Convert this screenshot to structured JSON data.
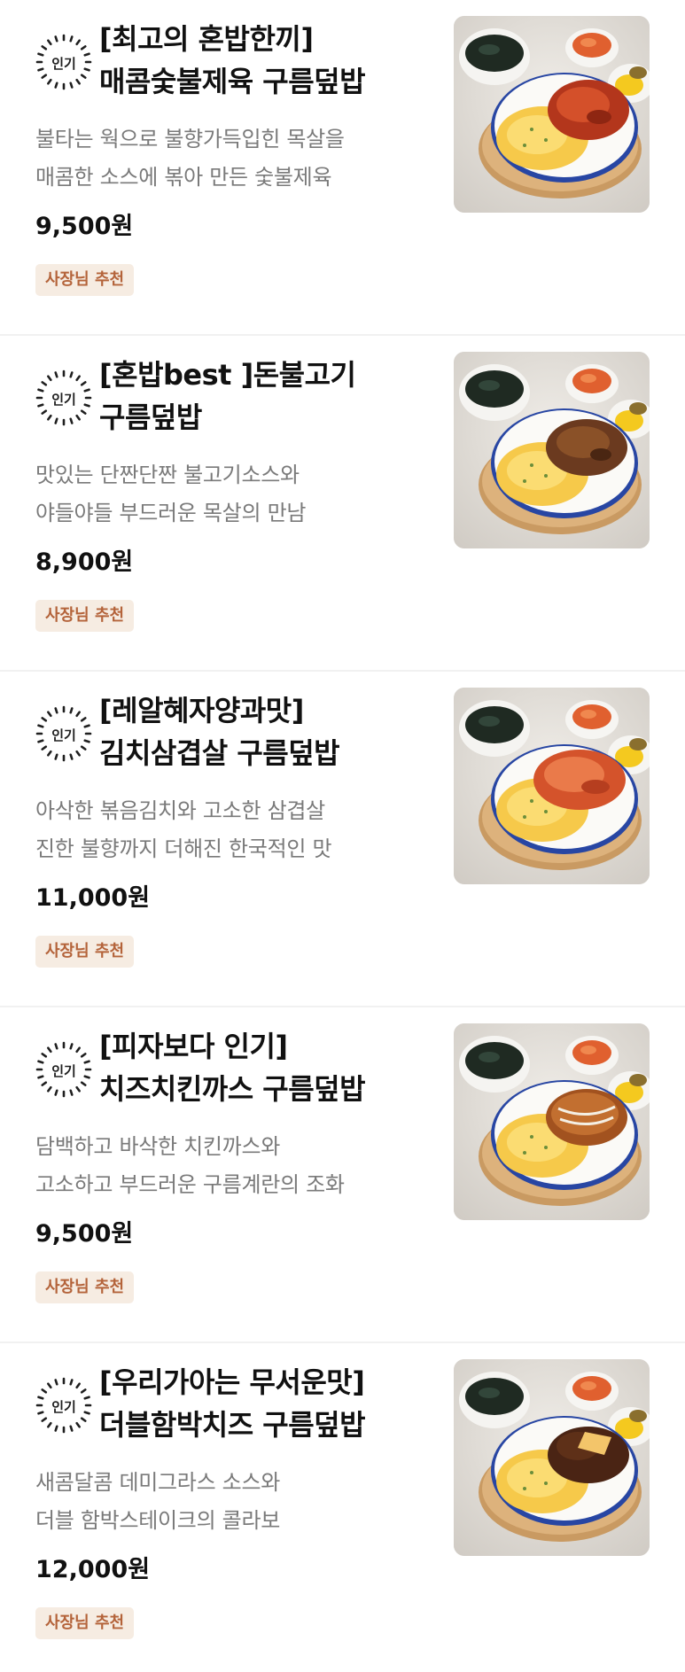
{
  "menu": {
    "items": [
      {
        "badge": "인기",
        "title_line1": "[최고의 혼밥한끼]",
        "title_line2": "매콤숯불제육 구름덮밥",
        "desc_line1": "불타는 웍으로 불향가득입힌 목살을",
        "desc_line2": "매콤한 소스에 볶아 만든 숯불제육",
        "price": "9,500원",
        "tag": "사장님 추천",
        "topping": "spicy-pork"
      },
      {
        "badge": "인기",
        "title_line1": "[혼밥best ]돈불고기",
        "title_line2": "구름덮밥",
        "desc_line1": "맛있는 단짠단짠 불고기소스와",
        "desc_line2": "야들야들 부드러운 목살의 만남",
        "price": "8,900원",
        "tag": "사장님 추천",
        "topping": "bulgogi"
      },
      {
        "badge": "인기",
        "title_line1": "[레알혜자양과맛]",
        "title_line2": "김치삼겹살 구름덮밥",
        "desc_line1": "아삭한 볶음김치와 고소한 삼겹살",
        "desc_line2": "진한 불향까지 더해진 한국적인 맛",
        "price": "11,000원",
        "tag": "사장님 추천",
        "topping": "kimchi-pork"
      },
      {
        "badge": "인기",
        "title_line1": "[피자보다 인기]",
        "title_line2": "치즈치킨까스 구름덮밥",
        "desc_line1": "담백하고 바삭한 치킨까스와",
        "desc_line2": "고소하고 부드러운 구름계란의 조화",
        "price": "9,500원",
        "tag": "사장님 추천",
        "topping": "chicken-cutlet"
      },
      {
        "badge": "인기",
        "title_line1": "[우리가아는 무서운맛]",
        "title_line2": "더블함박치즈 구름덮밥",
        "desc_line1": "새콤달콤 데미그라스 소스와",
        "desc_line2": "더블 함박스테이크의 콜라보",
        "price": "12,000원",
        "tag": "사장님 추천",
        "topping": "hamburg-steak"
      }
    ]
  }
}
